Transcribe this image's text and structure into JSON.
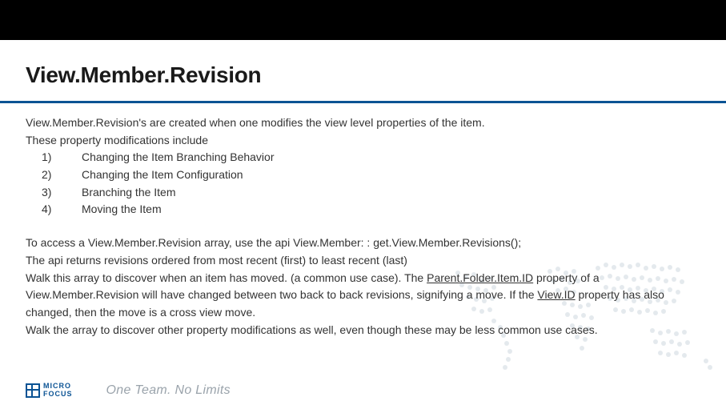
{
  "title": "View.Member.Revision",
  "intro1": "View.Member.Revision's are created when one modifies the view level properties of the item.",
  "intro2": "These property modifications include",
  "items": [
    {
      "num": "1)",
      "text": "Changing the Item Branching Behavior"
    },
    {
      "num": "2)",
      "text": "Changing the Item Configuration"
    },
    {
      "num": "3)",
      "text": "Branching the Item"
    },
    {
      "num": "4)",
      "text": "Moving the Item"
    }
  ],
  "para2": {
    "lead": "To access a View.Member.Revision array, use the api ",
    "api": "View.Member: : get.View.Member.Revisions();"
  },
  "para3": "The api returns revisions ordered from most recent (first) to least recent (last)",
  "para4": {
    "a": "Walk this array to discover when an item has moved. (a common use case). The ",
    "prop1": "Parent.Folder.Item.ID",
    "b": " property of a View.Member.Revision will have changed between two back to back revisions, signifying a move. If the ",
    "prop2": "View.ID",
    "c": " property has also changed, then the move is a cross view move."
  },
  "para5": "Walk the array to discover other property modifications as well, even though these may be less common use cases.",
  "logo": {
    "line1": "MICRO",
    "line2": "FOCUS"
  },
  "tagline": "One Team. No Limits"
}
